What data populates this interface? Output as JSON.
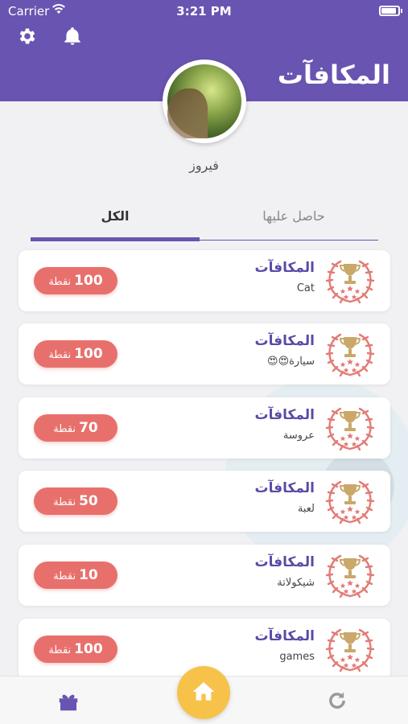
{
  "status_bar": {
    "carrier": "Carrier",
    "time": "3:21 PM"
  },
  "header": {
    "title": "المكافآت"
  },
  "profile": {
    "name": "فيروز"
  },
  "tabs": [
    {
      "label": "الكل",
      "active": true
    },
    {
      "label": "حاصل عليها",
      "active": false
    }
  ],
  "rewards": [
    {
      "title": "المكافآت",
      "subtitle": "Cat",
      "points": "100",
      "unit": "نقطة"
    },
    {
      "title": "المكافآت",
      "subtitle": "سيارة😍😍",
      "points": "100",
      "unit": "نقطة"
    },
    {
      "title": "المكافآت",
      "subtitle": "عروسة",
      "points": "70",
      "unit": "نقطة"
    },
    {
      "title": "المكافآت",
      "subtitle": "لعبة",
      "points": "50",
      "unit": "نقطة"
    },
    {
      "title": "المكافآت",
      "subtitle": "شيكولاتة",
      "points": "10",
      "unit": "نقطة"
    },
    {
      "title": "المكافآت",
      "subtitle": "games",
      "points": "100",
      "unit": "نقطة"
    }
  ],
  "colors": {
    "primary": "#6954b1",
    "accent": "#e8706c",
    "home": "#f7c24a"
  },
  "icons": {
    "settings": "gear-icon",
    "notifications": "bell-icon",
    "gift": "gift-icon",
    "home": "home-icon",
    "refresh": "refresh-icon",
    "badge": "trophy-laurel-icon"
  }
}
